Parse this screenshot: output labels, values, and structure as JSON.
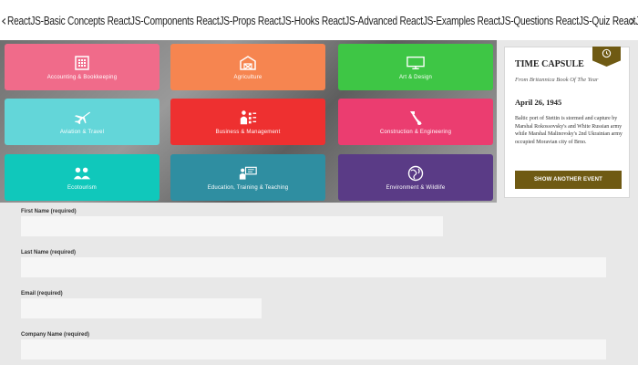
{
  "ticker": {
    "left_arrow": "‹",
    "text": "ReactJS-Basic Concepts ReactJS-Components ReactJS-Props ReactJS-Hooks ReactJS-Advanced ReactJS-Examples ReactJS-Questions ReactJS-Quiz ReactJS-Tutorial Web Development Web Techno",
    "right_arrow": "›"
  },
  "tiles": [
    {
      "label": "Accounting & Bookkeeping",
      "icon": "calculator-icon",
      "color": "#f06b8a"
    },
    {
      "label": "Agriculture",
      "icon": "barn-icon",
      "color": "#f68550"
    },
    {
      "label": "Art & Design",
      "icon": "monitor-icon",
      "color": "#3ec645"
    },
    {
      "label": "Aviation & Travel",
      "icon": "airplane-icon",
      "color": "#63d6d9"
    },
    {
      "label": "Business & Management",
      "icon": "org-chart-icon",
      "color": "#ee3030"
    },
    {
      "label": "Construction & Engineering",
      "icon": "crane-icon",
      "color": "#eb3d70"
    },
    {
      "label": "Ecotourism",
      "icon": "leaf-people-icon",
      "color": "#10c8bb"
    },
    {
      "label": "Education, Training & Teaching",
      "icon": "teacher-board-icon",
      "color": "#2f8ea1"
    },
    {
      "label": "Environment & Wildlife",
      "icon": "globe-icon",
      "color": "#5a3b86"
    }
  ],
  "time_capsule": {
    "title": "TIME CAPSULE",
    "subtitle": "From Britannica Book Of The Year",
    "date": "April 26, 1945",
    "body": "Baltic port of Stettin is stormed and capture by Marshal Rokossovsky's and White Russian army while Marshal Malinovsky's 2nd Ukrainian army occupied Moravian city of Brno.",
    "button": "SHOW ANOTHER EVENT",
    "accent": "#6f5a13"
  },
  "form": {
    "first_name_label": "First Name (required)",
    "last_name_label": "Last Name (required)",
    "email_label": "Email (required)",
    "company_label": "Company Name (required)",
    "first_name_value": "",
    "last_name_value": "",
    "email_value": "",
    "company_value": ""
  }
}
